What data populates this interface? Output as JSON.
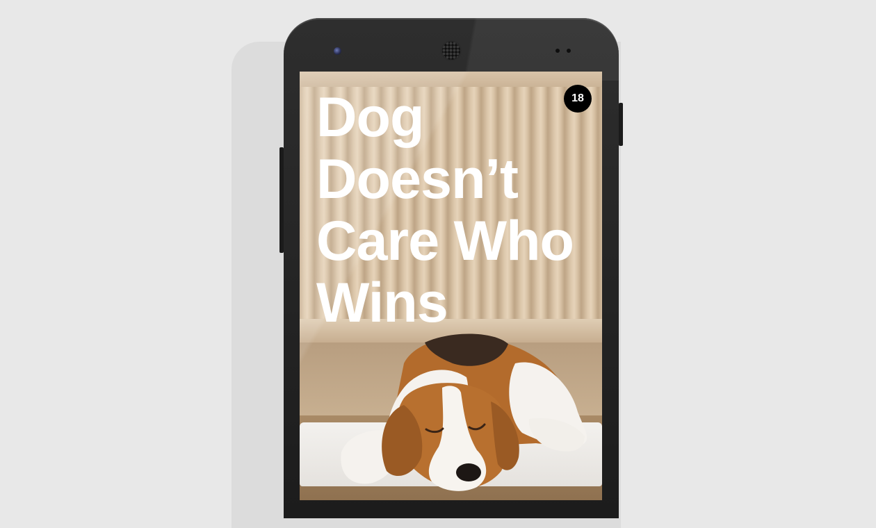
{
  "article": {
    "headline": "Dog Doesn’t Care Who Wins",
    "badge_count": "18"
  },
  "device": {
    "body_color": "#222222",
    "screen_accent": "#cdb89d"
  },
  "icons": {
    "front_camera": "front-camera-icon",
    "earpiece": "speaker-grille-icon"
  }
}
